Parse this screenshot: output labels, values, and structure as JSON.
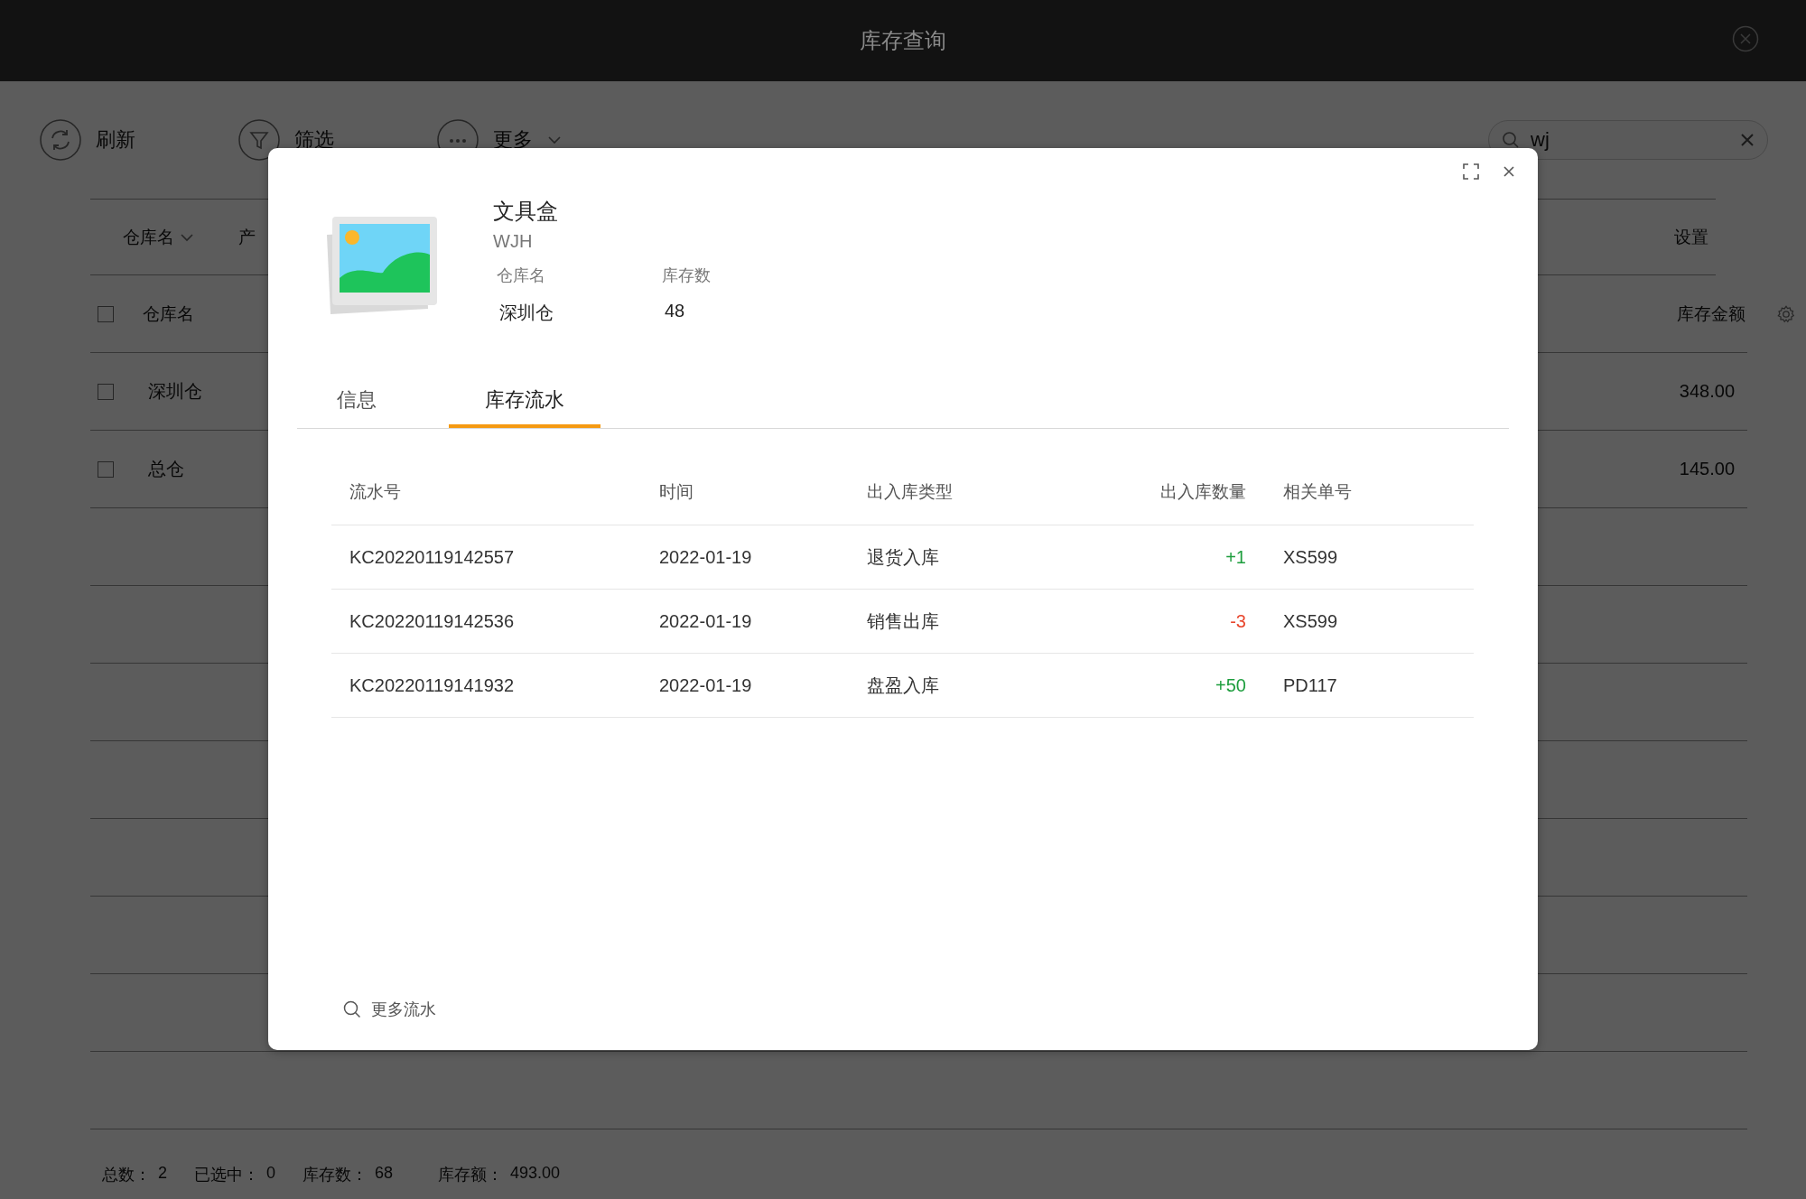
{
  "window": {
    "title": "库存查询"
  },
  "toolbar": [
    {
      "label": "刷新",
      "kind": "refresh"
    },
    {
      "label": "筛选",
      "kind": "filter"
    },
    {
      "label": "更多",
      "kind": "more"
    }
  ],
  "search": {
    "value": "wj"
  },
  "filter_bar": {
    "items": [
      {
        "label": "仓库名",
        "dropdown": true
      },
      {
        "label": "产",
        "dropdown": false
      }
    ],
    "settings": "设置"
  },
  "table": {
    "header_checked": false,
    "columns": [
      "仓库名",
      "库存金额"
    ],
    "rows": [
      {
        "checked": false,
        "cells": [
          "深圳仓",
          "348.00"
        ]
      },
      {
        "checked": false,
        "cells": [
          "总仓",
          "145.00"
        ]
      }
    ]
  },
  "status_bar": [
    {
      "label": "总数：",
      "value": "2"
    },
    {
      "label": "已选中：",
      "value": "0"
    },
    {
      "label": "库存数：",
      "value": "68"
    },
    {
      "label": "库存额：",
      "value": "493.00"
    }
  ],
  "dialog": {
    "product": {
      "name": "文具盒",
      "code": "WJH",
      "fields": [
        {
          "label": "仓库名",
          "value": "深圳仓"
        },
        {
          "label": "库存数",
          "value": "48"
        }
      ]
    },
    "tabs": [
      {
        "label": "信息",
        "selected": false
      },
      {
        "label": "库存流水",
        "selected": true
      }
    ],
    "flow_table": {
      "columns": [
        "流水号",
        "时间",
        "出入库类型",
        "出入库数量",
        "相关单号"
      ],
      "rows": [
        {
          "id": "KC20220119142557",
          "date": "2022-01-19",
          "type": "退货入库",
          "qty": "+1",
          "color": "#1e9e3e",
          "ref": "XS599"
        },
        {
          "id": "KC20220119142536",
          "date": "2022-01-19",
          "type": "销售出库",
          "qty": "-3",
          "color": "#e8452c",
          "ref": "XS599"
        },
        {
          "id": "KC20220119141932",
          "date": "2022-01-19",
          "type": "盘盈入库",
          "qty": "+50",
          "color": "#1e9e3e",
          "ref": "PD117"
        }
      ]
    },
    "more_link": "更多流水"
  }
}
